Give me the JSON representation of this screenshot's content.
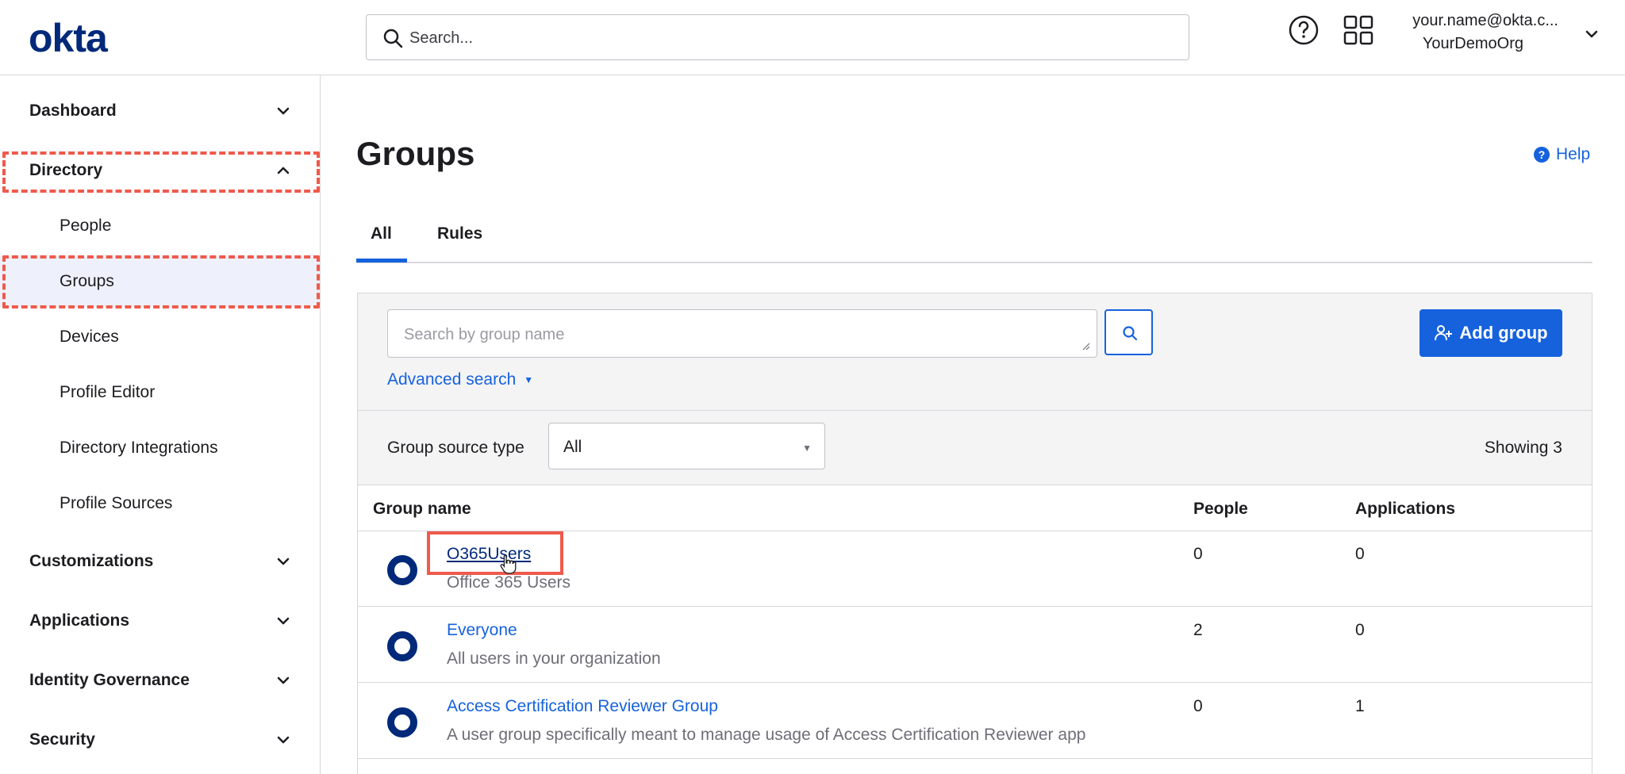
{
  "header": {
    "logo": "okta",
    "search_placeholder": "Search...",
    "user_email": "your.name@okta.c...",
    "user_org": "YourDemoOrg"
  },
  "sidebar": {
    "sections": [
      {
        "label": "Dashboard",
        "expanded": false
      },
      {
        "label": "Directory",
        "expanded": true,
        "items": [
          "People",
          "Groups",
          "Devices",
          "Profile Editor",
          "Directory Integrations",
          "Profile Sources"
        ],
        "active_item": "Groups"
      },
      {
        "label": "Customizations",
        "expanded": false
      },
      {
        "label": "Applications",
        "expanded": false
      },
      {
        "label": "Identity Governance",
        "expanded": false
      },
      {
        "label": "Security",
        "expanded": false
      }
    ]
  },
  "main": {
    "title": "Groups",
    "help_label": "Help",
    "tabs": [
      {
        "label": "All",
        "active": true
      },
      {
        "label": "Rules",
        "active": false
      }
    ],
    "group_search_placeholder": "Search by group name",
    "add_group_label": "Add group",
    "advanced_search_label": "Advanced search",
    "filter": {
      "label": "Group source type",
      "value": "All"
    },
    "showing": "Showing 3",
    "table": {
      "columns": [
        "Group name",
        "People",
        "Applications"
      ],
      "rows": [
        {
          "name": "O365Users",
          "description": "Office 365 Users",
          "people": "0",
          "applications": "0"
        },
        {
          "name": "Everyone",
          "description": "All users in your organization",
          "people": "2",
          "applications": "0"
        },
        {
          "name": "Access Certification Reviewer Group",
          "description": "A user group specifically meant to manage usage of Access Certification Reviewer app",
          "people": "0",
          "applications": "1"
        }
      ]
    }
  },
  "colors": {
    "accent": "#1662dd",
    "brand_navy": "#00297a",
    "annotation_red": "#ef5a4c",
    "active_nav_bg": "#eef1fc"
  }
}
